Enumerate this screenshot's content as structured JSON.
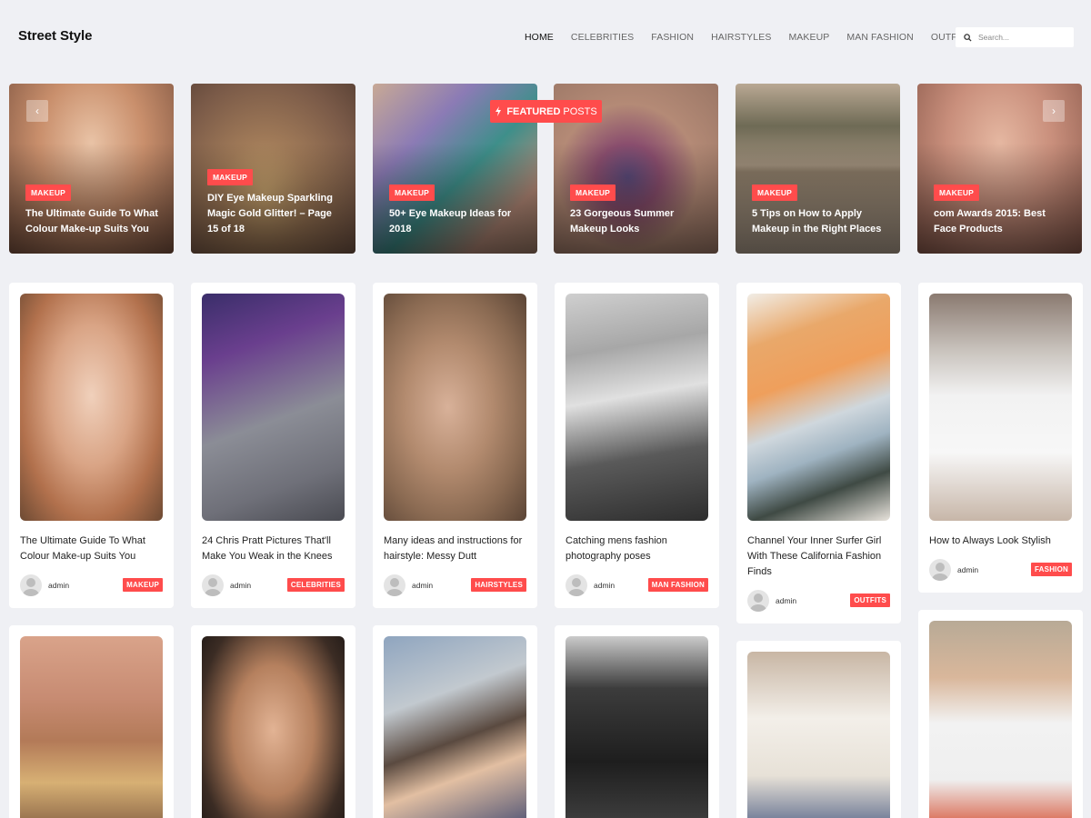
{
  "site": {
    "title": "Street Style"
  },
  "nav": [
    {
      "label": "HOME",
      "active": true
    },
    {
      "label": "CELEBRITIES"
    },
    {
      "label": "FASHION"
    },
    {
      "label": "HAIRSTYLES"
    },
    {
      "label": "MAKEUP"
    },
    {
      "label": "MAN FASHION"
    },
    {
      "label": "OUTFITS"
    }
  ],
  "search": {
    "placeholder": "Search..."
  },
  "featured_badge": {
    "bold": "FEATURED",
    "light": "POSTS"
  },
  "slider": {
    "prev": "‹",
    "next": "›"
  },
  "featured": [
    {
      "category": "MAKEUP",
      "title": "The Ultimate Guide To What Colour Make-up Suits You"
    },
    {
      "category": "MAKEUP",
      "title": "DIY Eye Makeup Sparkling Magic Gold Glitter! – Page 15 of 18"
    },
    {
      "category": "MAKEUP",
      "title": "50+ Eye Makeup Ideas for 2018"
    },
    {
      "category": "MAKEUP",
      "title": "23 Gorgeous Summer Makeup Looks"
    },
    {
      "category": "MAKEUP",
      "title": "5 Tips on How to Apply Makeup in the Right Places"
    },
    {
      "category": "MAKEUP",
      "title": "com Awards 2015: Best Face Products"
    }
  ],
  "posts": [
    {
      "title": "The Ultimate Guide To What Colour Make-up Suits You",
      "author": "admin",
      "category": "MAKEUP"
    },
    {
      "title": "24 Chris Pratt Pictures That'll Make You Weak in the Knees",
      "author": "admin",
      "category": "CELEBRITIES"
    },
    {
      "title": "Many ideas and instructions for hairstyle: Messy Dutt",
      "author": "admin",
      "category": "HAIRSTYLES"
    },
    {
      "title": "Catching mens fashion photography poses",
      "author": "admin",
      "category": "MAN FASHION"
    },
    {
      "title": "Channel Your Inner Surfer Girl With These California Fashion Finds",
      "author": "admin",
      "category": "OUTFITS"
    },
    {
      "title": "How to Always Look Stylish",
      "author": "admin",
      "category": "FASHION"
    }
  ],
  "colors": {
    "accent": "#ff4c4c",
    "background": "#eff0f4"
  }
}
